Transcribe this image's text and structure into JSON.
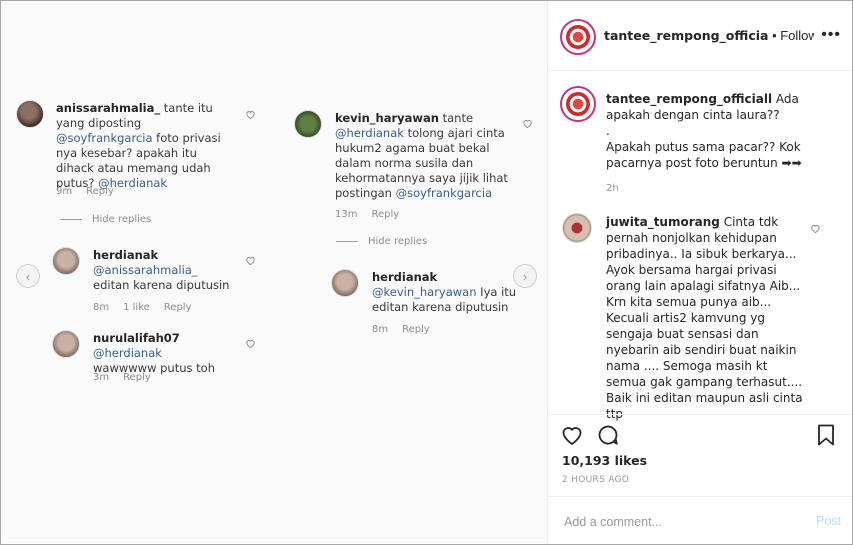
{
  "left": {
    "col1": {
      "top_comment": {
        "user": "anissarahmalia_",
        "text_pre": " tante itu yang diposting ",
        "mention": "@soyfrankgarcia",
        "text_post": " foto privasi nya kesebar? apakah itu dihack atau memang udah putus? ",
        "mention2": "@herdianak",
        "time": "9m",
        "reply": "Reply"
      },
      "hide_replies": "Hide replies",
      "reply1": {
        "user": "herdianak",
        "mention": "@anissarahmalia_",
        "text": " editan karena diputusin",
        "time": "8m",
        "likes": "1 like",
        "reply": "Reply"
      },
      "reply2": {
        "user": "nurulalifah07",
        "mention": "@herdianak",
        "text": "wawwwww putus toh",
        "time": "3m",
        "reply": "Reply"
      }
    },
    "col2": {
      "top_comment": {
        "user": "kevin_haryawan",
        "text_pre": " tante ",
        "mention": "@herdianak",
        "text_post": " tolong ajari cinta hukum2 agama buat bekal dalam norma susila dan kehormatannya saya jijik lihat postingan ",
        "mention2": "@soyfrankgarcia",
        "time": "13m",
        "reply": "Reply"
      },
      "hide_replies": "Hide replies",
      "reply1": {
        "user": "herdianak",
        "mention": "@kevin_haryawan",
        "text": " Iya itu editan karena diputusin",
        "time": "8m",
        "reply": "Reply"
      }
    },
    "prev_arrow": "‹",
    "next_arrow": "›"
  },
  "header": {
    "username": "tantee_rempong_officia",
    "separator": " • ",
    "follow_status": "Following",
    "more": "•••"
  },
  "caption": {
    "user": "tantee_rempong_officiall",
    "line1": " Ada apakah dengan cinta laura??",
    "line2": ".",
    "line3": "Apakah putus sama pacar?? Kok pacarnya post foto beruntun ➡➡",
    "time": "2h"
  },
  "comment": {
    "user": "juwita_tumorang",
    "text": " Cinta tdk pernah nonjolkan kehidupan pribadinya.. Ia sibuk berkarya... Ayok bersama hargai privasi orang lain apalagi sifatnya Aib... Krn kita semua punya aib... Kecuali artis2 kamvung yg sengaja buat sensasi dan nyebarin aib sendiri buat naikin nama .... Semoga masih kt semua gak gampang terhasut.... Baik ini editan maupun asli cinta ttp"
  },
  "actions": {
    "likes": "10,193 likes",
    "ago": "2 HOURS AGO"
  },
  "add_comment": {
    "placeholder": "Add a comment...",
    "post": "Post"
  },
  "colors": {
    "mention": "#375f8c",
    "post_disabled": "#b2dffc",
    "ring": "#c13584"
  }
}
